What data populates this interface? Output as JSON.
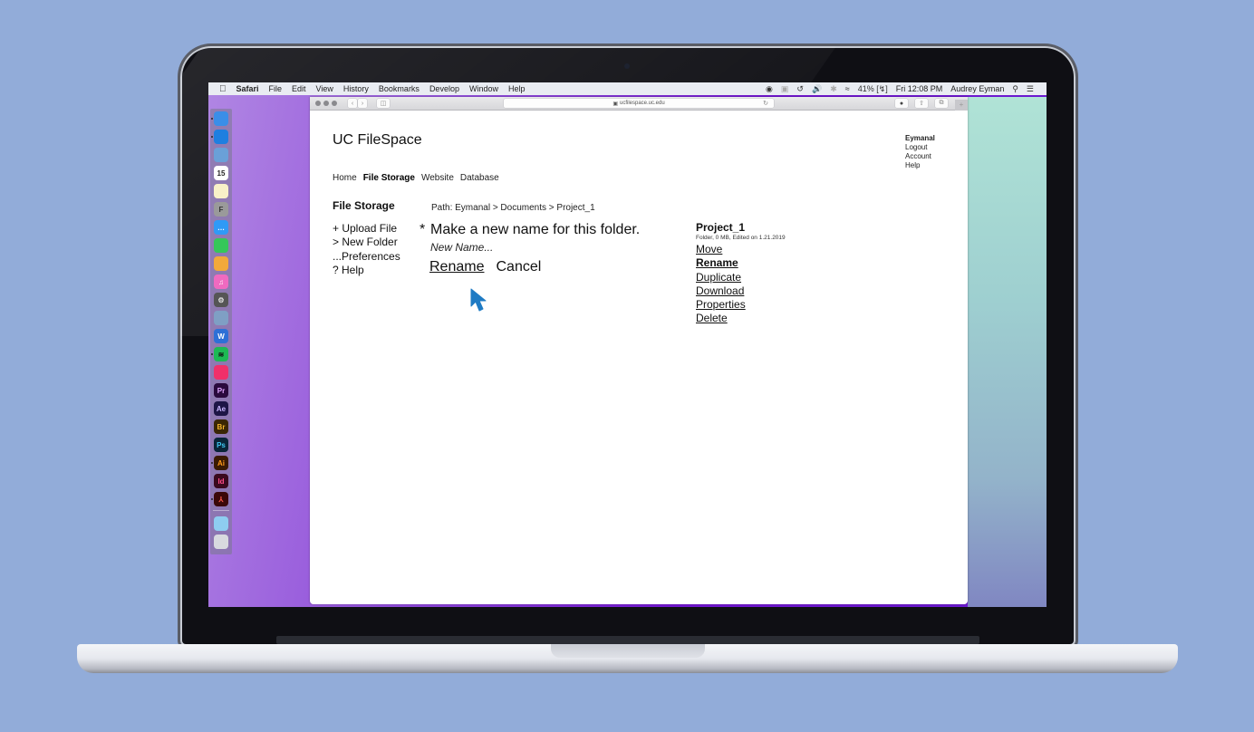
{
  "menubar": {
    "app_name": "Safari",
    "items": [
      "File",
      "Edit",
      "View",
      "History",
      "Bookmarks",
      "Develop",
      "Window",
      "Help"
    ],
    "battery": "41%",
    "clock": "Fri 12:08 PM",
    "user": "Audrey Eyman"
  },
  "browser": {
    "url": "ucfilespace.uc.edu"
  },
  "site": {
    "title": "UC FileSpace",
    "user_menu": {
      "username": "Eymanal",
      "items": [
        "Logout",
        "Account",
        "Help"
      ]
    },
    "nav": [
      {
        "label": "Home",
        "active": false
      },
      {
        "label": "File Storage",
        "active": true
      },
      {
        "label": "Website",
        "active": false
      },
      {
        "label": "Database",
        "active": false
      }
    ]
  },
  "main": {
    "section_title": "File Storage",
    "path": "Path: Eymanal > Documents > Project_1",
    "side_actions": [
      "+ Upload File",
      "> New Folder",
      "...Preferences",
      "? Help"
    ],
    "rename": {
      "asterisk": "*",
      "prompt": "Make a new name for this folder.",
      "input_placeholder": "New Name...",
      "input_value": "",
      "rename_label": "Rename",
      "cancel_label": "Cancel"
    },
    "details": {
      "name": "Project_1",
      "meta": "Folder, 0 MB, Edited on 1.21.2019",
      "actions": [
        "Move",
        "Rename",
        "Duplicate",
        "Download",
        "Properties",
        "Delete"
      ],
      "active_action": "Rename"
    }
  },
  "cursor": {
    "color": "#1f7bc4"
  },
  "dock": {
    "apps": [
      {
        "name": "finder",
        "label": "",
        "bg": "#3a8ee8",
        "fg": "#fff",
        "running": true
      },
      {
        "name": "safari",
        "label": "",
        "bg": "#1e7fe0",
        "fg": "#fff",
        "running": true
      },
      {
        "name": "preview",
        "label": "",
        "bg": "#6aa0d8",
        "fg": "#fff",
        "running": false
      },
      {
        "name": "calendar",
        "label": "15",
        "bg": "#ffffff",
        "fg": "#222",
        "running": false
      },
      {
        "name": "notes",
        "label": "",
        "bg": "#f8f1c8",
        "fg": "#222",
        "running": false
      },
      {
        "name": "fontbook",
        "label": "F",
        "bg": "#9a9a9a",
        "fg": "#333",
        "running": false
      },
      {
        "name": "messages",
        "label": "…",
        "bg": "#2f9af6",
        "fg": "#fff",
        "running": false
      },
      {
        "name": "facetime",
        "label": "",
        "bg": "#35c759",
        "fg": "#fff",
        "running": false
      },
      {
        "name": "photos",
        "label": "",
        "bg": "#f2a93b",
        "fg": "#fff",
        "running": false
      },
      {
        "name": "itunes",
        "label": "♫",
        "bg": "#f06ac0",
        "fg": "#fff",
        "running": false
      },
      {
        "name": "system-preferences",
        "label": "⚙",
        "bg": "#555555",
        "fg": "#ddd",
        "running": false
      },
      {
        "name": "image-capture",
        "label": "",
        "bg": "#7f9fc4",
        "fg": "#fff",
        "running": false
      },
      {
        "name": "word",
        "label": "W",
        "bg": "#2e70d6",
        "fg": "#fff",
        "running": false
      },
      {
        "name": "spotify",
        "label": "≋",
        "bg": "#1db954",
        "fg": "#111",
        "running": true
      },
      {
        "name": "screens",
        "label": "",
        "bg": "#f0306a",
        "fg": "#fff",
        "running": false
      },
      {
        "name": "premiere",
        "label": "Pr",
        "bg": "#2a0a3d",
        "fg": "#e2a7ff",
        "running": false
      },
      {
        "name": "after-effects",
        "label": "Ae",
        "bg": "#1d1546",
        "fg": "#c9b6ff",
        "running": false
      },
      {
        "name": "bridge",
        "label": "Br",
        "bg": "#3a2604",
        "fg": "#f5b52e",
        "running": false
      },
      {
        "name": "photoshop",
        "label": "Ps",
        "bg": "#0a2538",
        "fg": "#3fc7f4",
        "running": false
      },
      {
        "name": "illustrator",
        "label": "Ai",
        "bg": "#3a1a02",
        "fg": "#ff9a1a",
        "running": true
      },
      {
        "name": "indesign",
        "label": "Id",
        "bg": "#3a0a1e",
        "fg": "#ff4d8a",
        "running": false
      },
      {
        "name": "acrobat",
        "label": "⅄",
        "bg": "#3a0808",
        "fg": "#ff5a4a",
        "running": true
      },
      {
        "name": "downloads-folder",
        "label": "",
        "bg": "#8ecdf0",
        "fg": "#fff",
        "running": false
      },
      {
        "name": "trash",
        "label": "",
        "bg": "#d8dadf",
        "fg": "#fff",
        "running": false
      }
    ]
  }
}
